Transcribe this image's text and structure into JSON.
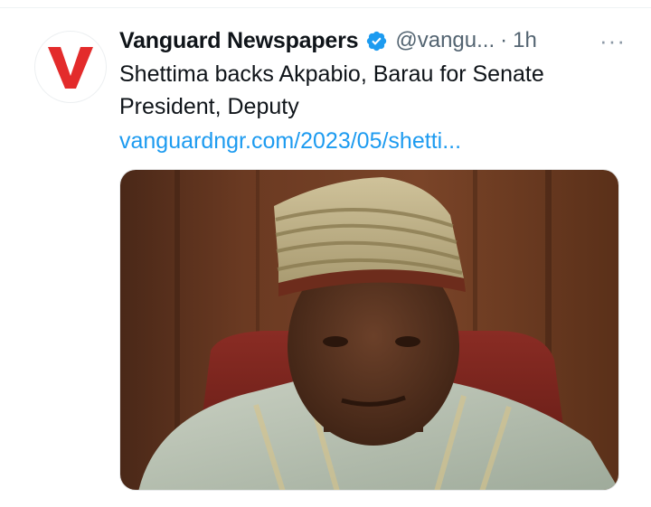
{
  "tweet": {
    "author_name": "Vanguard Newspapers",
    "handle": "@vangu...",
    "separator": "·",
    "time": "1h",
    "more_label": "···",
    "text_line1": "Shettima backs Akpabio, Barau for Senate",
    "text_line2": "President, Deputy",
    "link": "vanguardngr.com/2023/05/shetti..."
  },
  "avatar": {
    "logo_letter": "V",
    "logo_color": "#e32b2b"
  },
  "icons": {
    "verified": "verified-badge-icon",
    "more": "more-dots-icon"
  },
  "colors": {
    "verified": "#1d9bf0",
    "link": "#1d9bf0",
    "secondary_text": "#536471"
  }
}
